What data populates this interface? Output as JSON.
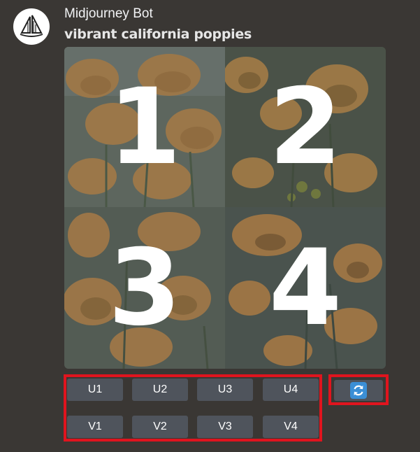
{
  "message": {
    "author": "Midjourney Bot",
    "prompt": "vibrant california poppies",
    "avatar_icon": "sailboat-icon"
  },
  "image_grid": {
    "tiles": [
      {
        "label": "1"
      },
      {
        "label": "2"
      },
      {
        "label": "3"
      },
      {
        "label": "4"
      }
    ]
  },
  "actions": {
    "upscale": [
      "U1",
      "U2",
      "U3",
      "U4"
    ],
    "variation": [
      "V1",
      "V2",
      "V3",
      "V4"
    ],
    "reroll_icon": "refresh-icon"
  },
  "colors": {
    "background": "#3a3734",
    "button": "#4f545c",
    "highlight": "#e0141e",
    "reroll_accent": "#3b8fd6",
    "poppy": "#f0a54a"
  }
}
